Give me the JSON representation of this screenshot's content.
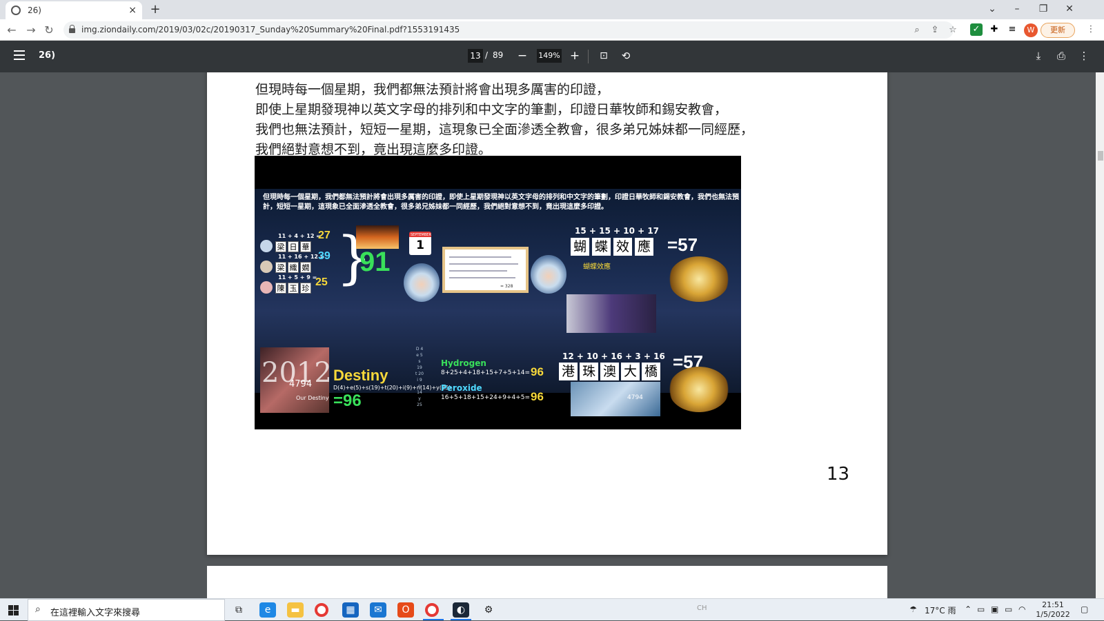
{
  "browser": {
    "tab_title": "26)",
    "tab_close": "×",
    "new_tab": "+",
    "url": "img.ziondaily.com/2019/03/02c/20190317_Sunday%20Summary%20Final.pdf?1553191435",
    "profile_initial": "W",
    "update_label": "更新"
  },
  "pdf_toolbar": {
    "doc_title": "26)",
    "current_page": "13",
    "separator": "/",
    "total_pages": "89",
    "zoom_out": "−",
    "zoom": "149%",
    "zoom_in": "+"
  },
  "page": {
    "paragraphs": [
      "但現時每一個星期，我們都無法預計將會出現多厲害的印證，",
      "即使上星期發現神以英文字母的排列和中文字的筆劃，印證日華牧師和錫安教會，",
      "我們也無法預計，短短一星期，這現象已全面滲透全教會，很多弟兄姊妹都一同經歷，",
      "我們絕對意想不到，竟出現這麼多印證。"
    ],
    "page_number": "13"
  },
  "slide": {
    "headline": "但現時每一個星期，我們都無法預計將會出現多厲害的印證，即使上星期發現神以英文字母的排列和中文字的筆劃，印證日華牧師和錫安教會，我們也無法預計，短短一星期，這現象已全面滲透全教會，很多弟兄姊妹都一同經歷，我們絕對意想不到，竟出現這麼多印證。",
    "people": [
      {
        "sum": "11 + 4 + 12 =",
        "total": "27",
        "chars": [
          "梁",
          "日",
          "華"
        ]
      },
      {
        "sum": "11 + 16 + 12 =",
        "total": "39",
        "chars": [
          "梁",
          "織",
          "嫺"
        ]
      },
      {
        "sum": "11 + 5 + 9 =",
        "total": "25",
        "chars": [
          "陳",
          "玉",
          "珍"
        ]
      }
    ],
    "total_91": "91",
    "calendar_month": "SEPTEMBER",
    "calendar_day": "1",
    "butterfly_sum": "15 + 15 + 10 + 17",
    "butterfly_chars": [
      "蝴",
      "蝶",
      "效",
      "應"
    ],
    "butterfly_caption": "蝴蝶效應",
    "result_57": "=57",
    "bridge_sum": "12 + 10 + 16 + 3 + 16",
    "bridge_chars": [
      "港",
      "珠",
      "澳",
      "大",
      "橋"
    ],
    "year": "2012",
    "year_sub": "4794",
    "year_caption": "Our Destiny",
    "destiny_label": "Destiny",
    "destiny_formula": "D(4)+e(5)+s(19)+t(20)+i(9)+n(14)+y(25)",
    "destiny_total": "=96",
    "destiny_column": [
      "D",
      "e",
      "s",
      "t",
      "i",
      "n",
      "y"
    ],
    "destiny_column_nums": [
      "4",
      "5",
      "19",
      "20",
      "9",
      "14",
      "25"
    ],
    "hydrogen_label": "Hydrogen",
    "hydrogen_formula": "8+25+4+18+15+7+5+14=",
    "peroxide_label": "Peroxide",
    "peroxide_formula": "16+5+18+15+24+9+4+5=",
    "result_96": "96",
    "photo_label": "4794",
    "board_total": "= 328"
  },
  "taskbar": {
    "search_placeholder": "在這裡輸入文字來搜尋",
    "weather": "17°C 雨",
    "ime": "CH",
    "time": "21:51",
    "date": "1/5/2022"
  },
  "colors": {
    "pdf_toolbar": "#323639",
    "viewer_bg": "#525659",
    "accent_green": "#39e05a",
    "accent_cyan": "#4fd9ff"
  }
}
